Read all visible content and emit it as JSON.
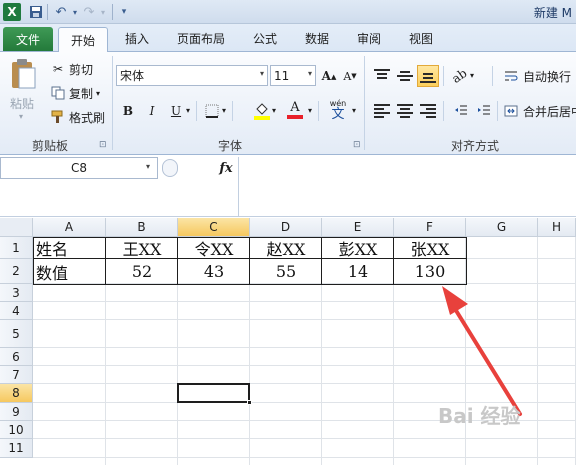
{
  "window": {
    "title": "新建 M"
  },
  "tabs": [
    "文件",
    "开始",
    "插入",
    "页面布局",
    "公式",
    "数据",
    "审阅",
    "视图"
  ],
  "clipboard": {
    "paste": "粘贴",
    "cut": "剪切",
    "copy": "复制",
    "format_painter": "格式刷",
    "label": "剪贴板"
  },
  "font": {
    "name": "宋体",
    "size": "11",
    "grow": "A",
    "shrink": "A",
    "bold": "B",
    "italic": "I",
    "underline": "U",
    "font_color_glyph": "A",
    "phonetic": "wén",
    "phonetic_char": "文",
    "label": "字体"
  },
  "alignment": {
    "wrap_text": "自动换行",
    "merge_center": "合并后居中",
    "label": "对齐方式"
  },
  "formula_bar": {
    "name_box": "C8",
    "fx": "fx",
    "value": ""
  },
  "columns": [
    "A",
    "B",
    "C",
    "D",
    "E",
    "F",
    "G",
    "H"
  ],
  "selected_column": "C",
  "rows": [
    "1",
    "2",
    "3",
    "4",
    "5",
    "6",
    "7",
    "8",
    "9",
    "10",
    "11"
  ],
  "selected_row": "8",
  "cells": {
    "row1": [
      "姓名",
      "王XX",
      "令XX",
      "赵XX",
      "彭XX",
      "张XX"
    ],
    "row2": [
      "数值",
      "52",
      "43",
      "55",
      "14",
      "130"
    ]
  },
  "colors": {
    "file_tab": "#237a3a",
    "arrow": "#e8413c",
    "selection": "#f6c85f"
  },
  "watermark": "Bai 经验"
}
